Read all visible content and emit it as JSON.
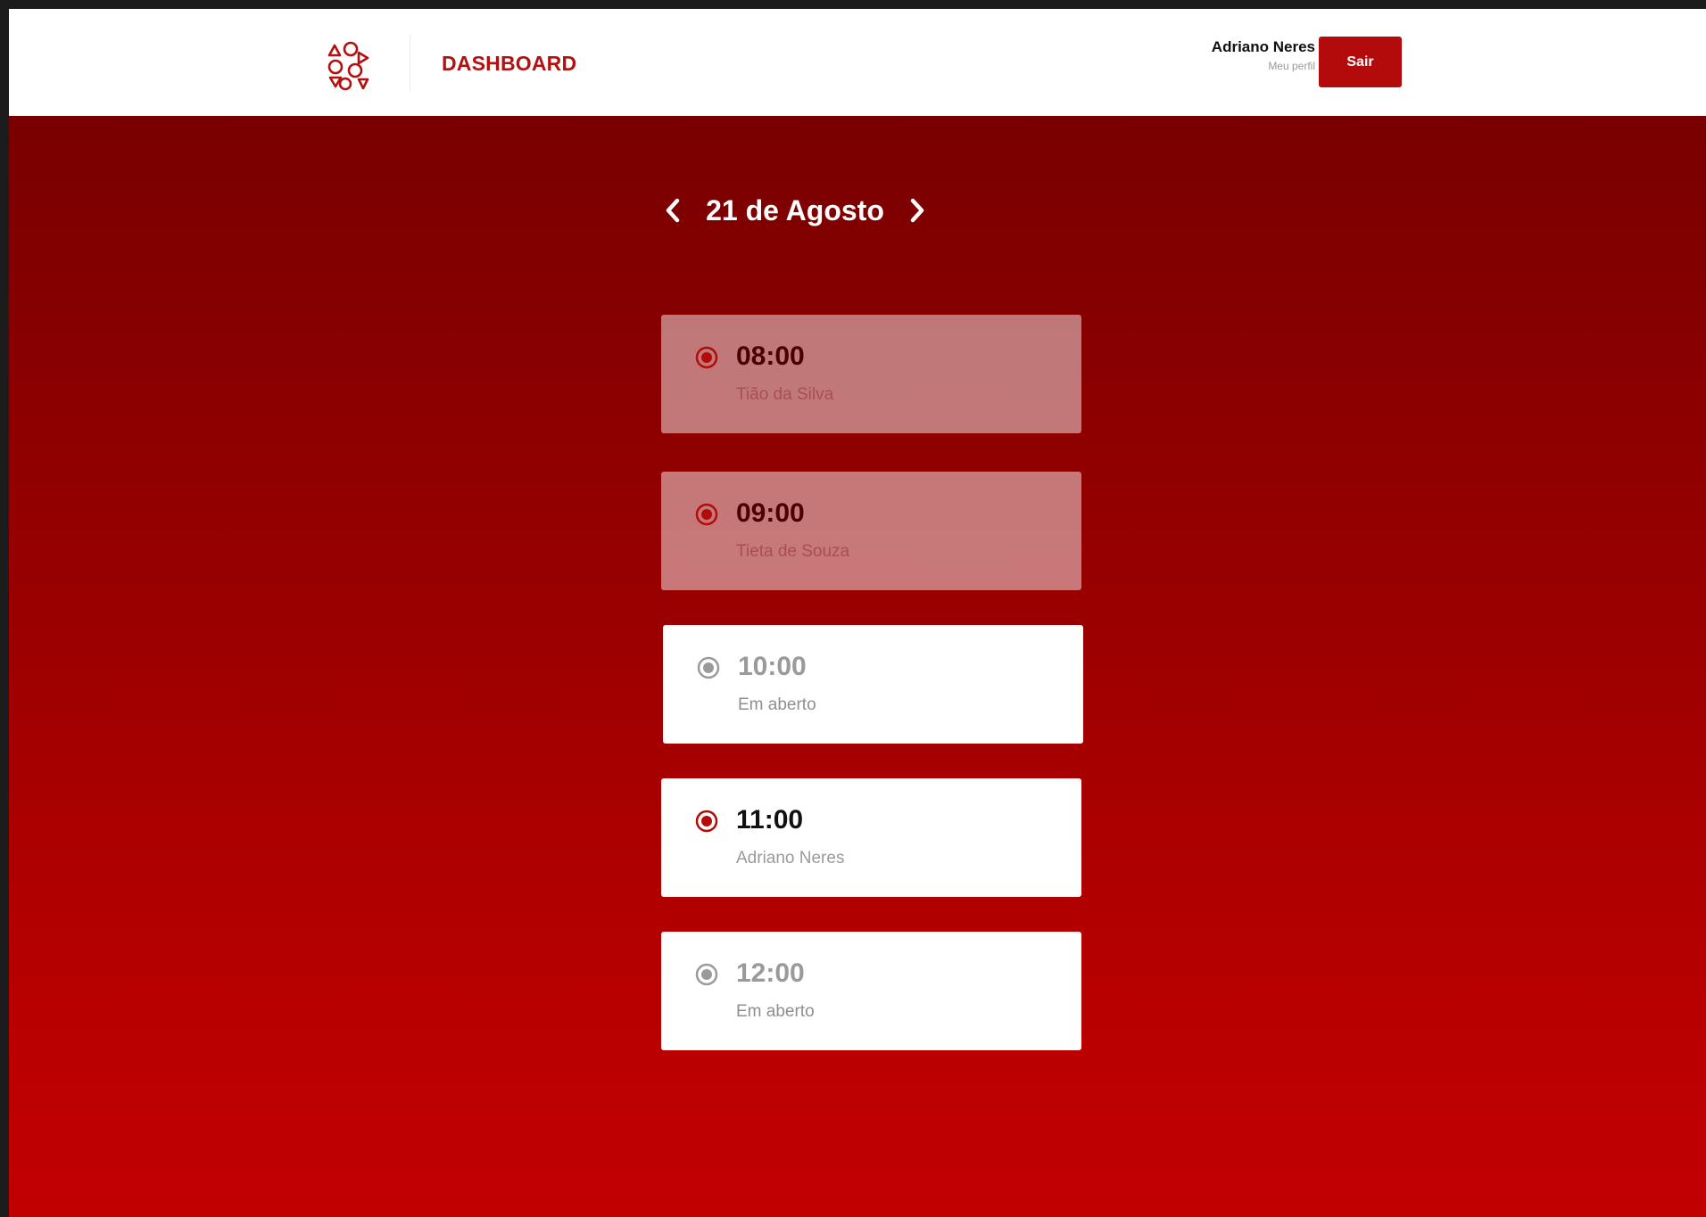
{
  "header": {
    "nav_title": "DASHBOARD",
    "user_name": "Adriano Neres",
    "profile_link": "Meu perfil",
    "logout_label": "Sair"
  },
  "schedule": {
    "date_label": "21 de Agosto",
    "prev_icon": "chevron-left-icon",
    "next_icon": "chevron-right-icon",
    "slots": [
      {
        "time": "08:00",
        "name": "Tião da Silva",
        "status": "booked"
      },
      {
        "time": "09:00",
        "name": "Tieta de Souza",
        "status": "booked"
      },
      {
        "time": "10:00",
        "name": "Em aberto",
        "status": "open"
      },
      {
        "time": "11:00",
        "name": "Adriano Neres",
        "status": "mine"
      },
      {
        "time": "12:00",
        "name": "Em aberto",
        "status": "open"
      }
    ]
  },
  "colors": {
    "brand_red": "#b30b0b",
    "radio_gray": "#9a9a9a",
    "header_bg": "#ffffff"
  }
}
